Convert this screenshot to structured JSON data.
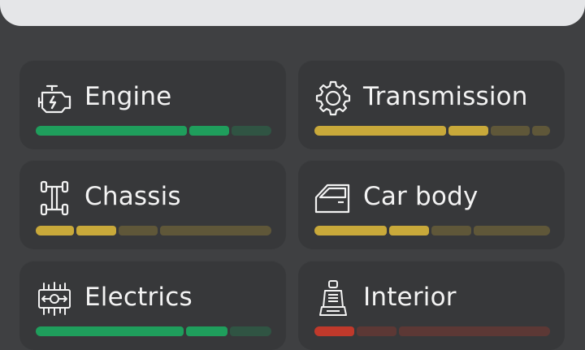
{
  "systems": [
    {
      "label": "Engine",
      "icon": "engine-icon",
      "status": "good",
      "status_color": "#1f9e5c",
      "level": 0.82,
      "segments": [
        {
          "fill": 1,
          "weight": 190
        },
        {
          "fill": 1,
          "weight": 50
        },
        {
          "fill": 0,
          "weight": 50
        }
      ]
    },
    {
      "label": "Transmission",
      "icon": "gear-icon",
      "status": "warning",
      "status_color": "#c9a93a",
      "level": 0.75,
      "segments": [
        {
          "fill": 1,
          "weight": 165
        },
        {
          "fill": 1,
          "weight": 50
        },
        {
          "fill": 0,
          "weight": 50
        },
        {
          "fill": 0,
          "weight": 22
        }
      ]
    },
    {
      "label": "Chassis",
      "icon": "chassis-icon",
      "status": "warning",
      "status_color": "#c9a93a",
      "level": 0.35,
      "segments": [
        {
          "fill": 1,
          "weight": 48
        },
        {
          "fill": 1,
          "weight": 50
        },
        {
          "fill": 0,
          "weight": 50
        },
        {
          "fill": 0,
          "weight": 140
        }
      ]
    },
    {
      "label": "Car body",
      "icon": "car-door-icon",
      "status": "warning",
      "status_color": "#c9a93a",
      "level": 0.5,
      "segments": [
        {
          "fill": 1,
          "weight": 90
        },
        {
          "fill": 1,
          "weight": 50
        },
        {
          "fill": 0,
          "weight": 50
        },
        {
          "fill": 0,
          "weight": 95
        }
      ]
    },
    {
      "label": "Electrics",
      "icon": "circuit-board-icon",
      "status": "good",
      "status_color": "#1f9e5c",
      "level": 0.8,
      "segments": [
        {
          "fill": 1,
          "weight": 178
        },
        {
          "fill": 1,
          "weight": 50
        },
        {
          "fill": 0,
          "weight": 50
        }
      ]
    },
    {
      "label": "Interior",
      "icon": "car-seat-icon",
      "status": "critical",
      "status_color": "#c0392b",
      "level": 0.18,
      "segments": [
        {
          "fill": 1,
          "weight": 50
        },
        {
          "fill": 0,
          "weight": 50
        },
        {
          "fill": 0,
          "weight": 190
        }
      ]
    }
  ],
  "colors": {
    "background": "#3f4042",
    "card": "#37383a",
    "top_panel": "#e5e6e8",
    "text": "#f3f3f3"
  }
}
